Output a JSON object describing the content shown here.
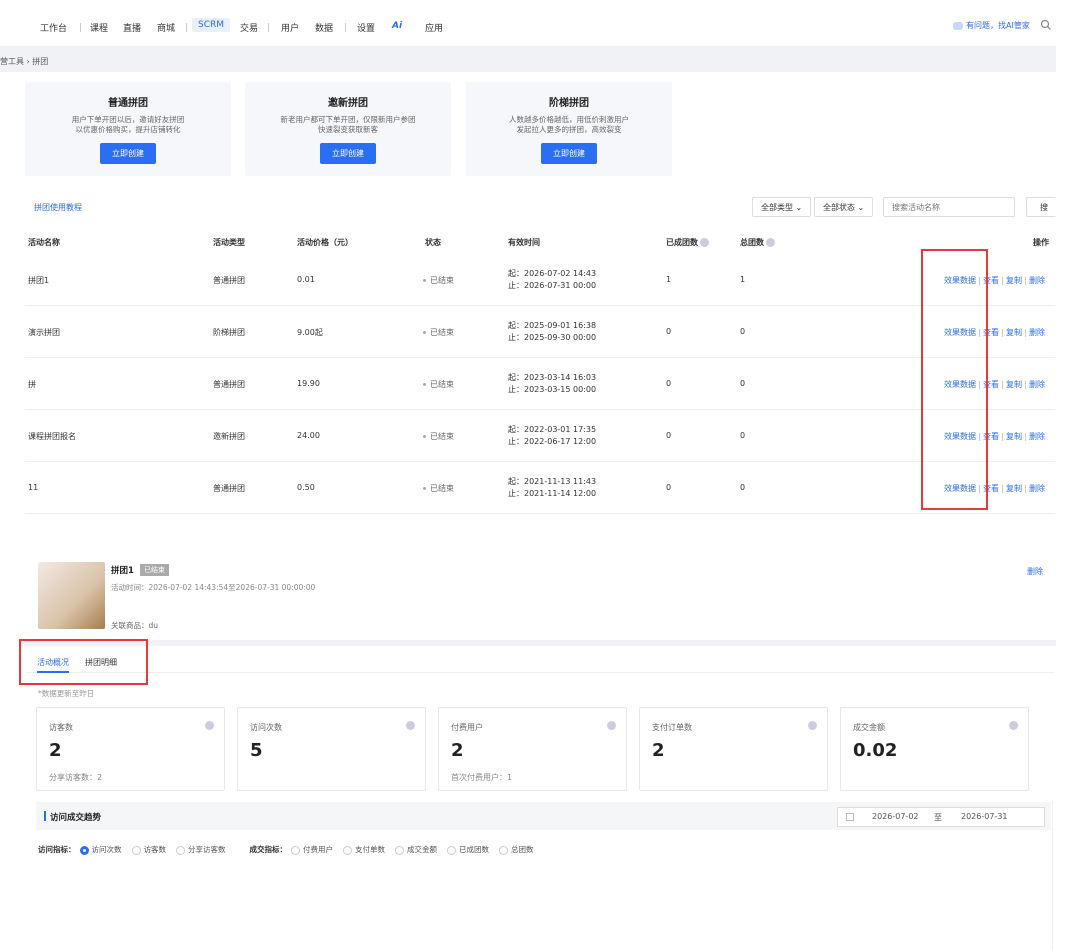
{
  "nav": {
    "items": [
      "工作台",
      "课程",
      "直播",
      "商城",
      "SCRM",
      "交易",
      "用户",
      "数据",
      "设置",
      "应用"
    ],
    "active": "SCRM",
    "ai_help": "有问题，找AI管家"
  },
  "breadcrumb": "营工具 › 拼团",
  "cards": [
    {
      "title": "普通拼团",
      "desc1": "用户下单开团以后，邀请好友拼团",
      "desc2": "以优惠价格购买，提升店铺转化",
      "button": "立即创建"
    },
    {
      "title": "邀新拼团",
      "desc1": "新老用户都可下单开团，仅限新用户参团",
      "desc2": "快速裂变获取新客",
      "button": "立即创建"
    },
    {
      "title": "阶梯拼团",
      "desc1": "人数越多价格越低，用低价刺激用户",
      "desc2": "发起拉人更多的拼团，高效裂变",
      "button": "立即创建"
    }
  ],
  "tutorial_link": "拼团使用教程",
  "filters": {
    "type": "全部类型",
    "status": "全部状态",
    "search_placeholder": "搜索活动名称",
    "search_button": "搜"
  },
  "table": {
    "headers": [
      "活动名称",
      "活动类型",
      "活动价格（元）",
      "状态",
      "有效时间",
      "已成团数",
      "总团数",
      "操作"
    ],
    "rows": [
      {
        "name": "拼团1",
        "type": "普通拼团",
        "price": "0.01",
        "status": "已结束",
        "start": "起：2026-07-02 14:43",
        "end": "止：2026-07-31 00:00",
        "done": "1",
        "total": "1"
      },
      {
        "name": "演示拼团",
        "type": "阶梯拼团",
        "price": "9.00起",
        "status": "已结束",
        "start": "起：2025-09-01 16:38",
        "end": "止：2025-09-30 00:00",
        "done": "0",
        "total": "0"
      },
      {
        "name": "拼",
        "type": "普通拼团",
        "price": "19.90",
        "status": "已结束",
        "start": "起：2023-03-14 16:03",
        "end": "止：2023-03-15 00:00",
        "done": "0",
        "total": "0"
      },
      {
        "name": "课程拼团报名",
        "type": "邀新拼团",
        "price": "24.00",
        "status": "已结束",
        "start": "起：2022-03-01 17:35",
        "end": "止：2022-06-17 12:00",
        "done": "0",
        "total": "0"
      },
      {
        "name": "11",
        "type": "普通拼团",
        "price": "0.50",
        "status": "已结束",
        "start": "起：2021-11-13 11:43",
        "end": "止：2021-11-14 12:00",
        "done": "0",
        "total": "0"
      }
    ],
    "ops": [
      "效果数据",
      "查看",
      "复制",
      "删除"
    ]
  },
  "detail": {
    "title": "拼团1",
    "badge": "已结束",
    "time": "活动时间：2026-07-02 14:43:54至2026-07-31 00:00:00",
    "product": "关联商品：du",
    "delete": "删除",
    "tabs": [
      "活动概况",
      "拼团明细"
    ],
    "note": "*数据更新至昨日",
    "stats": [
      {
        "title": "访客数",
        "value": "2",
        "sub": "分享访客数：2"
      },
      {
        "title": "访问次数",
        "value": "5",
        "sub": ""
      },
      {
        "title": "付费用户",
        "value": "2",
        "sub": "首次付费用户：1"
      },
      {
        "title": "支付订单数",
        "value": "2",
        "sub": ""
      },
      {
        "title": "成交金额",
        "value": "0.02",
        "sub": ""
      }
    ],
    "trend_title": "访问成交趋势",
    "date_from": "2026-07-02",
    "date_sep": "至",
    "date_to": "2026-07-31",
    "visit_label": "访问指标：",
    "visit_metrics": [
      "访问次数",
      "访客数",
      "分享访客数"
    ],
    "deal_label": "成交指标：",
    "deal_metrics": [
      "付费用户",
      "支付单数",
      "成交金额",
      "已成团数",
      "总团数"
    ]
  },
  "colors": {
    "accent": "#2a6ef1",
    "highlight": "#e8393a"
  }
}
